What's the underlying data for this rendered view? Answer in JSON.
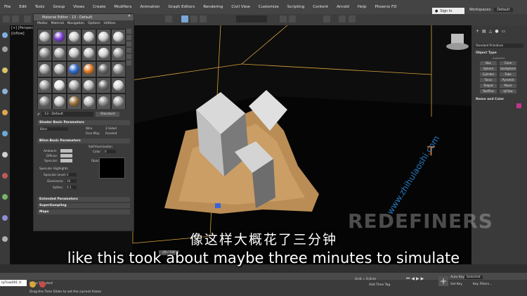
{
  "menu": {
    "items": [
      "File",
      "Edit",
      "Tools",
      "Group",
      "Views",
      "Create",
      "Modifiers",
      "Animation",
      "Graph Editors",
      "Rendering",
      "Civil View",
      "Customize",
      "Scripting",
      "Content",
      "Arnold",
      "Help",
      "Phoenix FD"
    ],
    "sign_in": "Sign In",
    "workspace_label": "Workspaces:",
    "workspace_value": "Default"
  },
  "viewport": {
    "label_line1": "[+] [Perspective",
    "label_line2": "[Ixflow]"
  },
  "material_editor": {
    "title": "Material Editor - 13 - Default",
    "menu": [
      "Modes",
      "Material",
      "Navigation",
      "Options",
      "Utilities"
    ],
    "material_name": "13 - Default",
    "material_type": "Standard",
    "rollouts": {
      "shader_basic": "Shader Basic Parameters",
      "blinn_basic": "Blinn Basic Parameters",
      "extended": "Extended Parameters",
      "supersampling": "SuperSampling",
      "maps": "Maps"
    },
    "shader": "Blinn",
    "options": [
      "Wire",
      "2-Sided",
      "Face Map",
      "Faceted"
    ],
    "self_illumination": "Self-Illumination",
    "color_label": "Color",
    "color_value": "0",
    "ambient": "Ambient:",
    "diffuse": "Diffuse:",
    "specular": "Specular:",
    "opacity_label": "Opacity:",
    "opacity_value": "100",
    "specular_highlights": "Specular Highlights",
    "specular_level_label": "Specular Level:",
    "specular_level_value": "0",
    "glossiness_label": "Glossiness:",
    "glossiness_value": "10",
    "soften_label": "Soften:",
    "soften_value": "0.1"
  },
  "command_panel": {
    "category": "Standard Primitives",
    "object_type_header": "Object Type",
    "autogrid": "AutoGrid",
    "buttons": [
      "Box",
      "Cone",
      "Sphere",
      "GeoSphere",
      "Cylinder",
      "Tube",
      "Torus",
      "Pyramid",
      "Teapot",
      "Plane",
      "TextPlus",
      "tyFlow"
    ],
    "name_color_header": "Name and Color"
  },
  "timeline": {
    "frame_display": "29 / 100"
  },
  "status": {
    "maxscript": "tyFlow001 (t",
    "selection": "None Selected",
    "hint": "Drag the Time Slider to set the current frame",
    "grid": "Grid = 0,0cm",
    "add_time_tag": "Add Time Tag",
    "auto_key": "Auto Key",
    "set_key": "Set Key",
    "selected": "Selected",
    "key_filters": "Key Filters..."
  },
  "subtitles": {
    "chinese": "像这样大概花了三分钟",
    "english": "like this took about maybe three minutes to simulate"
  },
  "watermark": {
    "text": "REDEFINERS",
    "url": "www.zhihulaoshi.com"
  }
}
